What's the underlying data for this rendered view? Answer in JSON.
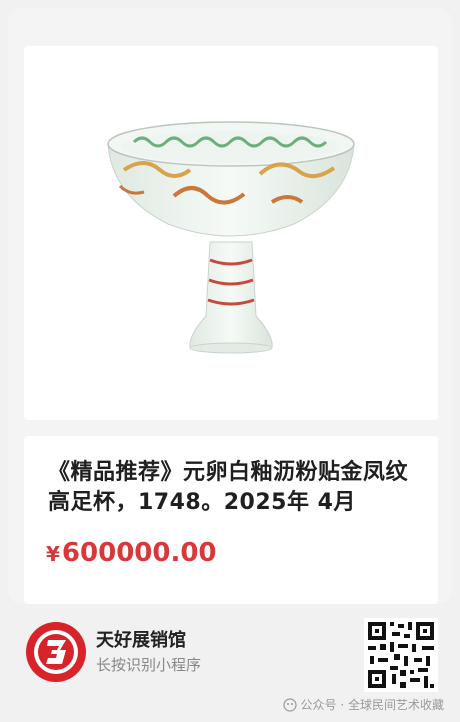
{
  "product": {
    "title": "《精品推荐》元卵白釉沥粉贴金凤纹高足杯，1748。2025年 4月",
    "currency": "¥",
    "price": "600000.00",
    "image_icon": "porcelain-stem-cup-image"
  },
  "footer": {
    "app_name": "天好展销馆",
    "hint": "长按识别小程序",
    "logo_icon": "app-logo-icon",
    "qr_icon": "qr-code-icon"
  },
  "watermark": {
    "text": "公众号 · 全球民间艺术收藏",
    "icon": "wechat-official-account-icon"
  },
  "colors": {
    "price": "#d9383a",
    "logo_red": "#d8232a"
  }
}
